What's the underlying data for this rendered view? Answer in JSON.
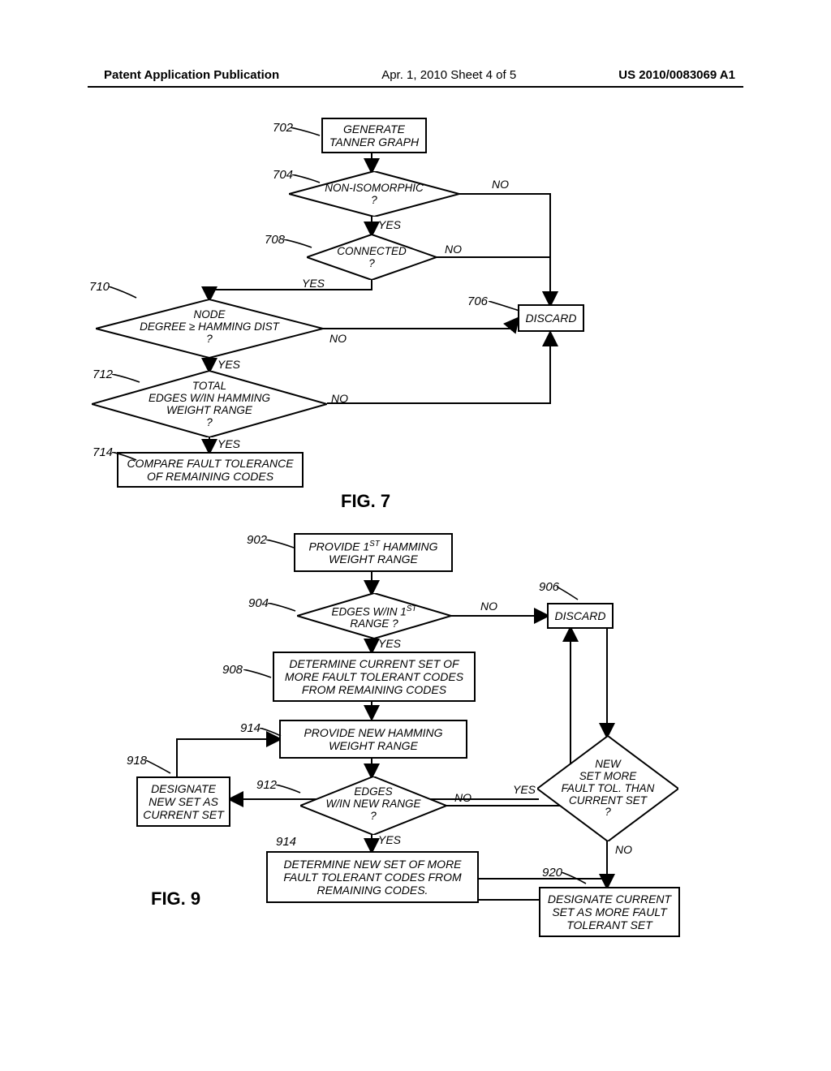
{
  "header": {
    "left": "Patent Application Publication",
    "center": "Apr. 1, 2010  Sheet 4 of 5",
    "right": "US 2010/0083069 A1"
  },
  "fig7": {
    "label": "FIG. 7",
    "refs": {
      "r702": "702",
      "r704": "704",
      "r706": "706",
      "r708": "708",
      "r710": "710",
      "r712": "712",
      "r714": "714"
    },
    "b702": "GENERATE\nTANNER GRAPH",
    "d704": "NON-ISOMORPHIC\n?",
    "b706": "DISCARD",
    "d708": "CONNECTED\n?",
    "d710": "NODE\nDEGREE ≥ HAMMING DIST\n?",
    "d712": "TOTAL\nEDGES W/IN HAMMING\nWEIGHT RANGE\n?",
    "b714": "COMPARE FAULT TOLERANCE\nOF REMAINING CODES",
    "yes": "YES",
    "no": "NO"
  },
  "fig9": {
    "label": "FIG. 9",
    "refs": {
      "r902": "902",
      "r904": "904",
      "r906": "906",
      "r908": "908",
      "r912": "912",
      "r914a": "914",
      "r914b": "914",
      "r918": "918",
      "r920": "920"
    },
    "b902": "PROVIDE 1ST HAMMING\nWEIGHT RANGE",
    "d904": "EDGES W/IN 1ST\nRANGE ?",
    "b906": "DISCARD",
    "b908": "DETERMINE CURRENT SET OF\nMORE FAULT TOLERANT CODES\nFROM REMAINING CODES",
    "b914a": "PROVIDE NEW HAMMING\nWEIGHT RANGE",
    "d912": "EDGES\nW/IN NEW RANGE\n?",
    "b914b": "DETERMINE NEW SET OF MORE\nFAULT TOLERANT CODES FROM\nREMAINING CODES.",
    "d_new": "NEW\nSET MORE\nFAULT TOL. THAN\nCURRENT SET\n?",
    "b918": "DESIGNATE\nNEW SET AS\nCURRENT SET",
    "b920": "DESIGNATE CURRENT\nSET AS MORE FAULT\nTOLERANT SET",
    "yes": "YES",
    "no": "NO"
  }
}
